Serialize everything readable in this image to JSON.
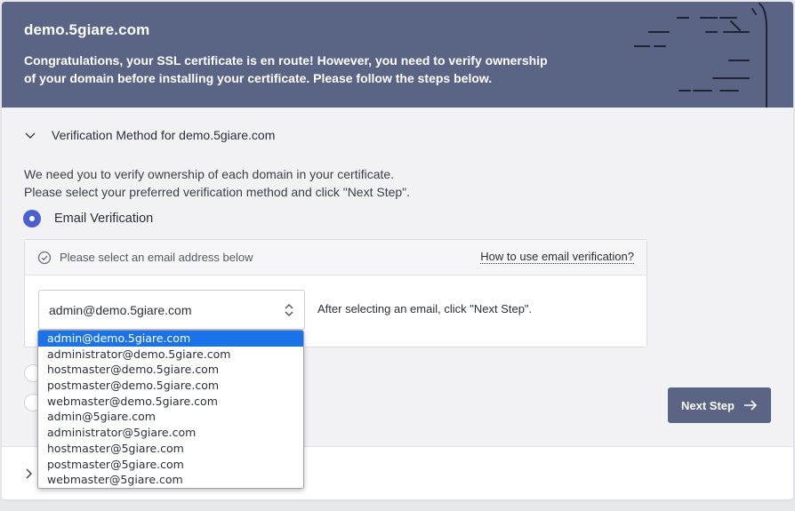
{
  "banner": {
    "domain": "demo.5giare.com",
    "message_line1": "Congratulations, your SSL certificate is en route! However, you need to verify ownership",
    "message_line2": "of your domain before installing your certificate. Please follow the steps below."
  },
  "section": {
    "title": "Verification Method for demo.5giare.com",
    "intro_line1": "We need you to verify ownership of each domain in your certificate.",
    "intro_line2": "Please select your preferred verification method and click \"Next Step\"."
  },
  "method": {
    "label": "Email Verification",
    "selected": true
  },
  "email_box": {
    "header": "Please select an email address below",
    "help_link": "How to use email verification?",
    "selected_email": "admin@demo.5giare.com",
    "after_text": "After selecting an email, click \"Next Step\"."
  },
  "dropdown": {
    "options": [
      "admin@demo.5giare.com",
      "administrator@demo.5giare.com",
      "hostmaster@demo.5giare.com",
      "postmaster@demo.5giare.com",
      "webmaster@demo.5giare.com",
      "admin@5giare.com",
      "administrator@5giare.com",
      "hostmaster@5giare.com",
      "postmaster@5giare.com",
      "webmaster@5giare.com"
    ],
    "highlighted_index": 0
  },
  "next_button": {
    "label": "Next Step"
  },
  "colors": {
    "banner": "#5a6585",
    "accent_radio": "#4a5fd0",
    "selected_option": "#1a73e8"
  },
  "icons": {
    "section_toggle": "chevron-down-icon",
    "header_check": "check-circle-icon",
    "select_arrows": "updown-arrows-icon",
    "next": "arrow-right-icon",
    "bottom_toggle": "chevron-right-icon"
  }
}
